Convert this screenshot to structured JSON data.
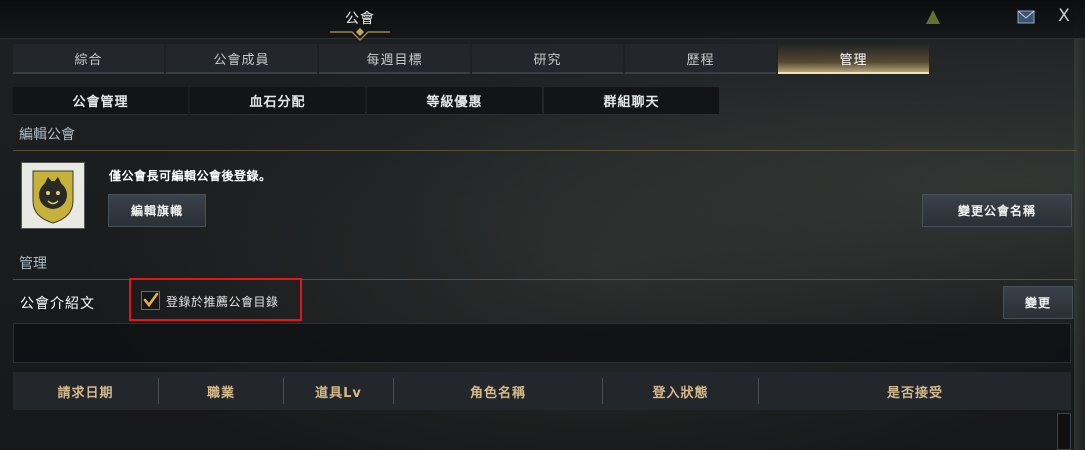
{
  "window": {
    "title": "公會",
    "close_label": "X"
  },
  "main_tabs": [
    {
      "label": "綜合",
      "active": false
    },
    {
      "label": "公會成員",
      "active": false
    },
    {
      "label": "每週目標",
      "active": false
    },
    {
      "label": "研究",
      "active": false
    },
    {
      "label": "歷程",
      "active": false
    },
    {
      "label": "管理",
      "active": true
    }
  ],
  "sub_tabs": [
    {
      "label": "公會管理"
    },
    {
      "label": "血石分配"
    },
    {
      "label": "等級優惠"
    },
    {
      "label": "群組聊天"
    }
  ],
  "edit_section": {
    "title": "編輯公會",
    "note": "僅公會長可編輯公會後登錄。",
    "edit_flag_button": "編輯旗幟",
    "rename_button": "變更公會名稱",
    "emblem_icon": "lion-crest-icon"
  },
  "manage_section": {
    "title": "管理",
    "intro_label": "公會介紹文",
    "register_checkbox": {
      "label": "登錄於推薦公會目錄",
      "checked": true
    },
    "change_button": "變更",
    "intro_text": ""
  },
  "table": {
    "columns": [
      "請求日期",
      "職業",
      "道具Lv",
      "角色名稱",
      "登入狀態",
      "是否接受"
    ]
  },
  "colors": {
    "accent_gold": "#d6b98a",
    "active_tab_glow": "#f6e2b0",
    "highlight_red": "#e01818"
  }
}
